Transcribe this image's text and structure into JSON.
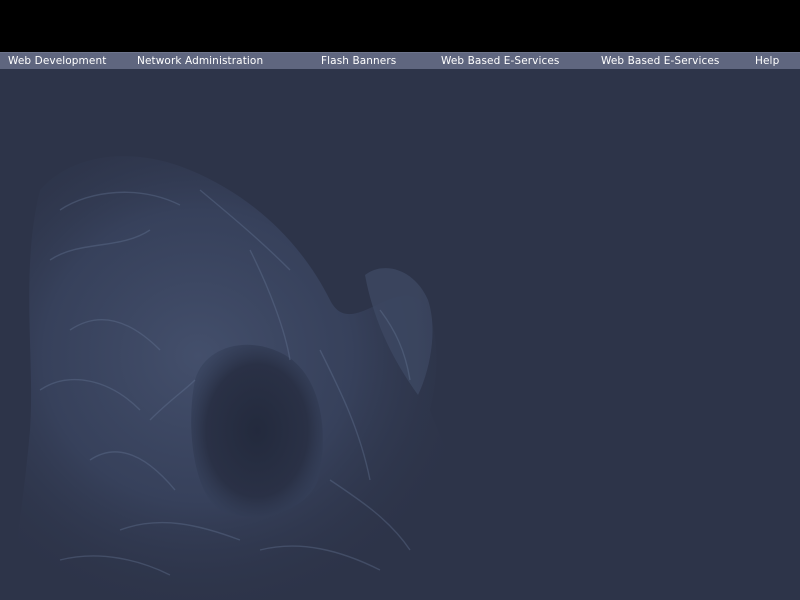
{
  "nav": {
    "items": [
      {
        "label": "Web Development"
      },
      {
        "label": "Network Administration"
      },
      {
        "label": "Flash Banners"
      },
      {
        "label": "Web Based E-Services"
      },
      {
        "label": "Web Based E-Services"
      },
      {
        "label": "Help"
      }
    ]
  },
  "colors": {
    "background": "#2d3449",
    "top_bar": "#000000",
    "nav_bar": "#5f667f",
    "nav_text": "#ffffff"
  },
  "decor": {
    "background_image": "cave-rock-arch-image"
  }
}
